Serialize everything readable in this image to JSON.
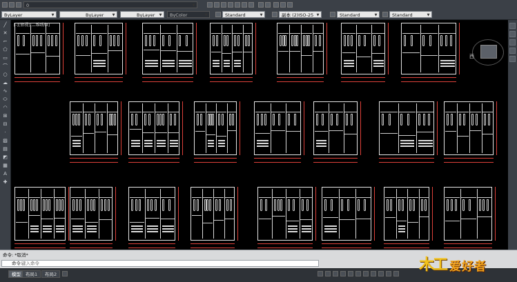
{
  "properties_toolbar": {
    "layer_state_value": "0",
    "color_value": "ByLayer",
    "linetype_value": "ByLayer",
    "lineweight_value": "ByLayer",
    "plotstyle_value": "ByColor",
    "text_style_value": "Standard",
    "dim_style_value": "副本 (2)ISO-25",
    "table_style_value": "Standard",
    "mleader_style_value": "Standard"
  },
  "viewcube": {
    "face_label": "西"
  },
  "origin_label": "[-][俯视][二维线框]",
  "command": {
    "history": "命令: *取消*",
    "prompt_label": "命令:",
    "placeholder": "键入命令"
  },
  "layout_tabs": [
    {
      "label": "模型"
    },
    {
      "label": "布局1"
    },
    {
      "label": "布局2"
    }
  ],
  "watermark": {
    "char1": "木",
    "char2": "工",
    "text": "爱好者"
  },
  "colors": {
    "canvas": "#000000",
    "drawing": "#e6e6e6",
    "dimension": "#e0413a",
    "ui_dark": "#3b4047"
  }
}
